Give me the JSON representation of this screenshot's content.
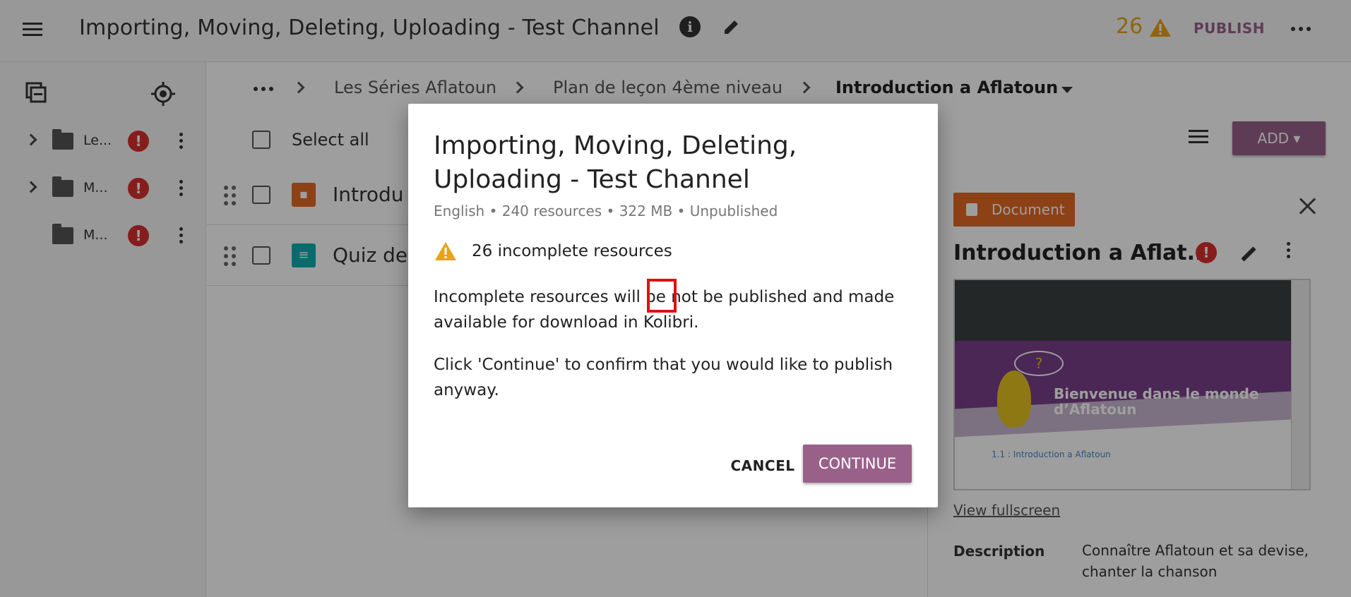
{
  "app": {
    "title": "Importing, Moving, Deleting, Uploading - Test Channel",
    "incomplete_count": "26",
    "publish_label": "PUBLISH"
  },
  "sidebar": {
    "items": [
      {
        "label": "Le...",
        "expandable": true
      },
      {
        "label": "M...",
        "expandable": true
      },
      {
        "label": "M...",
        "expandable": false
      }
    ],
    "error_glyph": "!"
  },
  "breadcrumb": {
    "items": [
      "Les Séries Aflatoun",
      "Plan de leçon 4ème niveau"
    ],
    "current": "Introduction a Aflatoun"
  },
  "toolbar": {
    "select_all_label": "Select all",
    "add_label": "ADD ▾"
  },
  "content_list": {
    "rows": [
      {
        "title": "Introdu",
        "kind": "document",
        "color": "#e46a24",
        "icon": "▪"
      },
      {
        "title": "Quiz de",
        "kind": "exercise",
        "color": "#0eafaf",
        "icon": "≡"
      }
    ]
  },
  "details_panel": {
    "kind_label": "Document",
    "title": "Introduction a Aflat...",
    "preview": {
      "question": "?",
      "heading_line1": "Bienvenue dans le monde",
      "heading_line2": "d’Aflatoun",
      "subheading": "1.1 : Introduction a Aflatoun"
    },
    "view_fullscreen_label": "View fullscreen",
    "description_label": "Description",
    "description_text": "Connaître Aflatoun et sa devise, chanter la chanson"
  },
  "modal": {
    "title": "Importing, Moving, Deleting, Uploading - Test Channel",
    "meta": "English • 240 resources • 322 MB • Unpublished",
    "warning_text": "26 incomplete resources",
    "paragraph1": "Incomplete resources will be not be published and made available for download in Kolibri.",
    "paragraph2": "Click 'Continue' to confirm that you would like to publish anyway.",
    "cancel_label": "CANCEL",
    "continue_label": "CONTINUE"
  },
  "colors": {
    "accent": "#996189",
    "warning": "#e8a317",
    "error": "#d92f2f",
    "document": "#e46a24",
    "exercise": "#0eafaf",
    "highlight": "#e01010"
  }
}
